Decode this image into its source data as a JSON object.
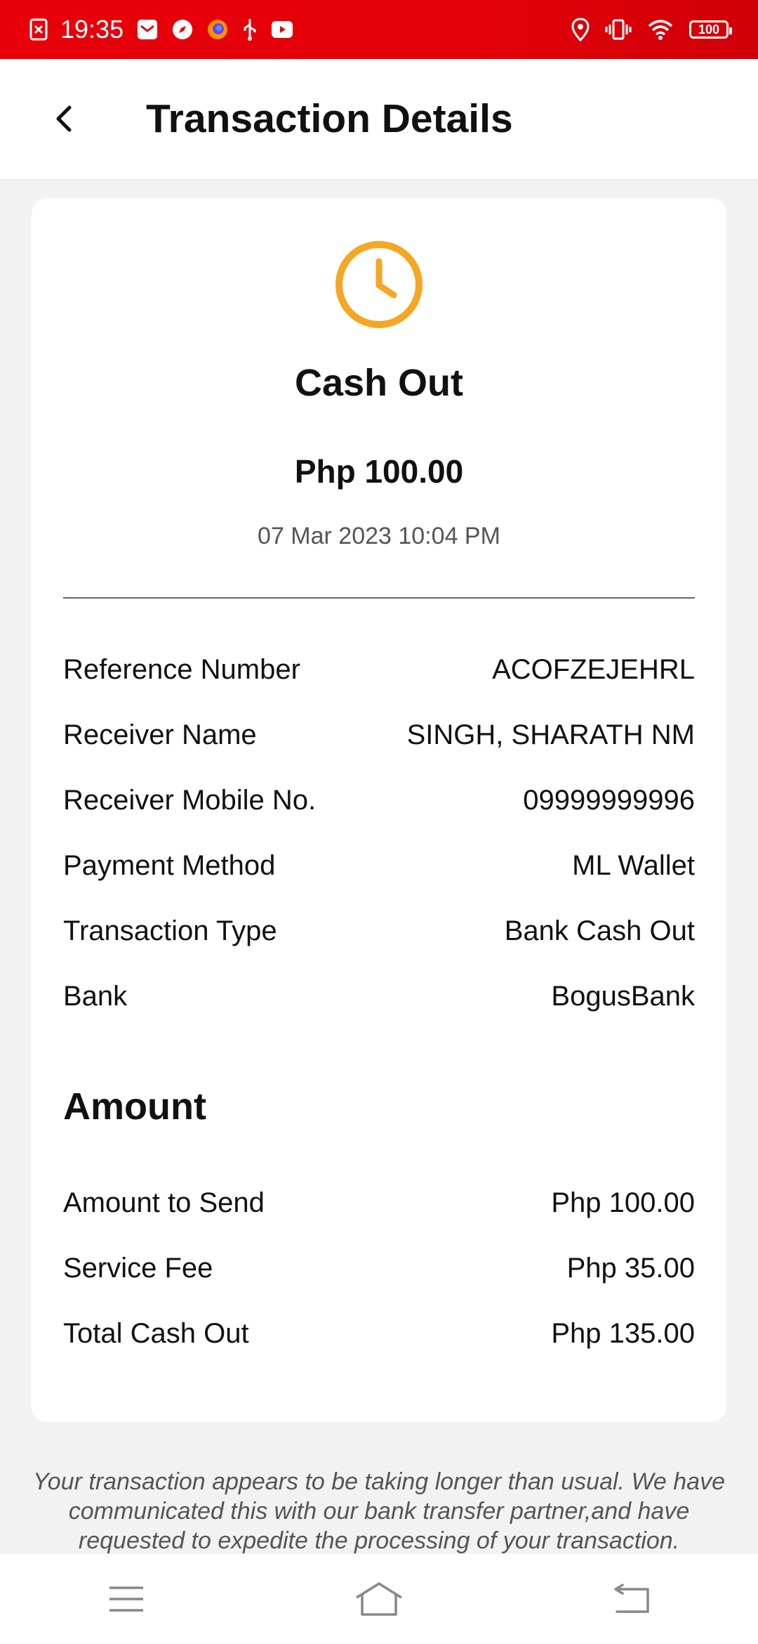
{
  "status_bar": {
    "time": "19:35",
    "battery": "100",
    "icons_left": [
      "blocked-notification-icon",
      "mail-icon",
      "compass-icon",
      "firefox-icon",
      "usb-icon",
      "youtube-icon"
    ],
    "icons_right": [
      "location-icon",
      "vibrate-icon",
      "wifi-icon",
      "battery-icon"
    ]
  },
  "header": {
    "title": "Transaction Details"
  },
  "summary": {
    "status_icon": "clock-icon",
    "status_color": "#F5A623",
    "title": "Cash Out",
    "amount": "Php 100.00",
    "date": "07 Mar 2023 10:04 PM"
  },
  "details": [
    {
      "label": "Reference Number",
      "value": "ACOFZEJEHRL"
    },
    {
      "label": "Receiver Name",
      "value": "SINGH, SHARATH NM"
    },
    {
      "label": "Receiver Mobile No.",
      "value": "09999999996"
    },
    {
      "label": "Payment Method",
      "value": "ML Wallet"
    },
    {
      "label": "Transaction Type",
      "value": "Bank Cash Out"
    },
    {
      "label": "Bank",
      "value": "BogusBank"
    }
  ],
  "amount_section": {
    "heading": "Amount",
    "rows": [
      {
        "label": "Amount to Send",
        "value": "Php 100.00"
      },
      {
        "label": "Service Fee",
        "value": "Php 35.00"
      },
      {
        "label": "Total Cash Out",
        "value": "Php 135.00"
      }
    ]
  },
  "notice": "Your transaction appears to be taking longer than usual. We have communicated this with our bank transfer partner,and have requested to expedite the processing of your transaction.",
  "colors": {
    "status_bar": "#E8000A",
    "accent_clock": "#F5A623"
  }
}
